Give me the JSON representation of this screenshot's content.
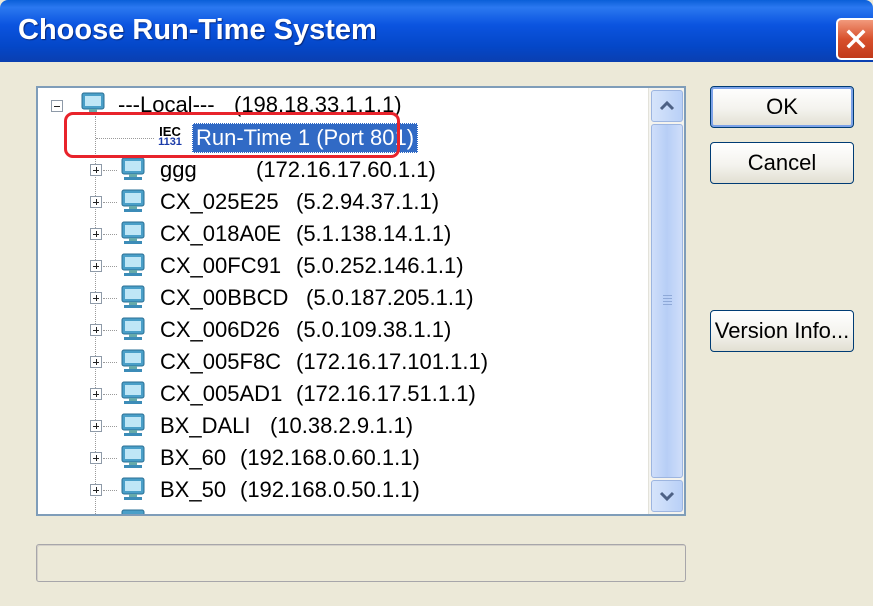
{
  "window": {
    "title": "Choose Run-Time System"
  },
  "tree": {
    "root": {
      "label": "---Local---",
      "address": "(198.18.33.1.1.1)",
      "expanded": true,
      "icon": "pc-icon"
    },
    "runtime": {
      "icon_line1": "IEC",
      "icon_line2": "1131",
      "label": "Run-Time 1 (Port 801)",
      "selected": true
    },
    "items": [
      {
        "name": "ggg",
        "address": "(172.16.17.60.1.1)"
      },
      {
        "name": "CX_025E25",
        "address": "(5.2.94.37.1.1)"
      },
      {
        "name": "CX_018A0E",
        "address": "(5.1.138.14.1.1)"
      },
      {
        "name": "CX_00FC91",
        "address": "(5.0.252.146.1.1)"
      },
      {
        "name": "CX_00BBCD",
        "address": "(5.0.187.205.1.1)"
      },
      {
        "name": "CX_006D26",
        "address": "(5.0.109.38.1.1)"
      },
      {
        "name": "CX_005F8C",
        "address": "(172.16.17.101.1.1)"
      },
      {
        "name": "CX_005AD1",
        "address": "(172.16.17.51.1.1)"
      },
      {
        "name": "BX_DALI",
        "address": "(10.38.2.9.1.1)"
      },
      {
        "name": "BX_60",
        "address": "(192.168.0.60.1.1)"
      },
      {
        "name": "BX_50",
        "address": "(192.168.0.50.1.1)"
      }
    ]
  },
  "buttons": {
    "ok": "OK",
    "cancel": "Cancel",
    "version_info": "Version Info..."
  },
  "status": {
    "text": ""
  },
  "colors": {
    "title_bar": "#0b54e0",
    "selection": "#316ac5",
    "highlight": "#e8232b",
    "dialog_bg": "#ece9d8"
  }
}
